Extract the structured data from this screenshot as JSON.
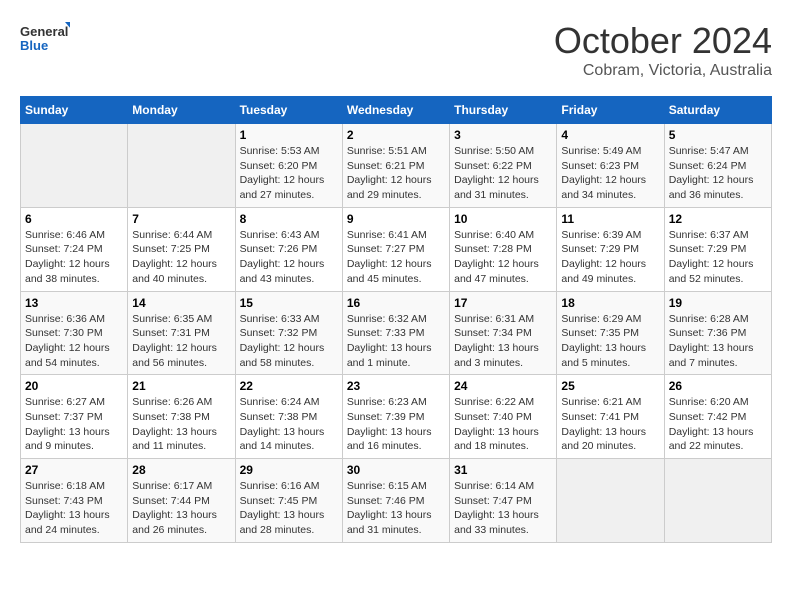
{
  "header": {
    "logo_line1": "General",
    "logo_line2": "Blue",
    "month_title": "October 2024",
    "location": "Cobram, Victoria, Australia"
  },
  "days_of_week": [
    "Sunday",
    "Monday",
    "Tuesday",
    "Wednesday",
    "Thursday",
    "Friday",
    "Saturday"
  ],
  "weeks": [
    [
      {
        "day": "",
        "info": ""
      },
      {
        "day": "",
        "info": ""
      },
      {
        "day": "1",
        "info": "Sunrise: 5:53 AM\nSunset: 6:20 PM\nDaylight: 12 hours\nand 27 minutes."
      },
      {
        "day": "2",
        "info": "Sunrise: 5:51 AM\nSunset: 6:21 PM\nDaylight: 12 hours\nand 29 minutes."
      },
      {
        "day": "3",
        "info": "Sunrise: 5:50 AM\nSunset: 6:22 PM\nDaylight: 12 hours\nand 31 minutes."
      },
      {
        "day": "4",
        "info": "Sunrise: 5:49 AM\nSunset: 6:23 PM\nDaylight: 12 hours\nand 34 minutes."
      },
      {
        "day": "5",
        "info": "Sunrise: 5:47 AM\nSunset: 6:24 PM\nDaylight: 12 hours\nand 36 minutes."
      }
    ],
    [
      {
        "day": "6",
        "info": "Sunrise: 6:46 AM\nSunset: 7:24 PM\nDaylight: 12 hours\nand 38 minutes."
      },
      {
        "day": "7",
        "info": "Sunrise: 6:44 AM\nSunset: 7:25 PM\nDaylight: 12 hours\nand 40 minutes."
      },
      {
        "day": "8",
        "info": "Sunrise: 6:43 AM\nSunset: 7:26 PM\nDaylight: 12 hours\nand 43 minutes."
      },
      {
        "day": "9",
        "info": "Sunrise: 6:41 AM\nSunset: 7:27 PM\nDaylight: 12 hours\nand 45 minutes."
      },
      {
        "day": "10",
        "info": "Sunrise: 6:40 AM\nSunset: 7:28 PM\nDaylight: 12 hours\nand 47 minutes."
      },
      {
        "day": "11",
        "info": "Sunrise: 6:39 AM\nSunset: 7:29 PM\nDaylight: 12 hours\nand 49 minutes."
      },
      {
        "day": "12",
        "info": "Sunrise: 6:37 AM\nSunset: 7:29 PM\nDaylight: 12 hours\nand 52 minutes."
      }
    ],
    [
      {
        "day": "13",
        "info": "Sunrise: 6:36 AM\nSunset: 7:30 PM\nDaylight: 12 hours\nand 54 minutes."
      },
      {
        "day": "14",
        "info": "Sunrise: 6:35 AM\nSunset: 7:31 PM\nDaylight: 12 hours\nand 56 minutes."
      },
      {
        "day": "15",
        "info": "Sunrise: 6:33 AM\nSunset: 7:32 PM\nDaylight: 12 hours\nand 58 minutes."
      },
      {
        "day": "16",
        "info": "Sunrise: 6:32 AM\nSunset: 7:33 PM\nDaylight: 13 hours\nand 1 minute."
      },
      {
        "day": "17",
        "info": "Sunrise: 6:31 AM\nSunset: 7:34 PM\nDaylight: 13 hours\nand 3 minutes."
      },
      {
        "day": "18",
        "info": "Sunrise: 6:29 AM\nSunset: 7:35 PM\nDaylight: 13 hours\nand 5 minutes."
      },
      {
        "day": "19",
        "info": "Sunrise: 6:28 AM\nSunset: 7:36 PM\nDaylight: 13 hours\nand 7 minutes."
      }
    ],
    [
      {
        "day": "20",
        "info": "Sunrise: 6:27 AM\nSunset: 7:37 PM\nDaylight: 13 hours\nand 9 minutes."
      },
      {
        "day": "21",
        "info": "Sunrise: 6:26 AM\nSunset: 7:38 PM\nDaylight: 13 hours\nand 11 minutes."
      },
      {
        "day": "22",
        "info": "Sunrise: 6:24 AM\nSunset: 7:38 PM\nDaylight: 13 hours\nand 14 minutes."
      },
      {
        "day": "23",
        "info": "Sunrise: 6:23 AM\nSunset: 7:39 PM\nDaylight: 13 hours\nand 16 minutes."
      },
      {
        "day": "24",
        "info": "Sunrise: 6:22 AM\nSunset: 7:40 PM\nDaylight: 13 hours\nand 18 minutes."
      },
      {
        "day": "25",
        "info": "Sunrise: 6:21 AM\nSunset: 7:41 PM\nDaylight: 13 hours\nand 20 minutes."
      },
      {
        "day": "26",
        "info": "Sunrise: 6:20 AM\nSunset: 7:42 PM\nDaylight: 13 hours\nand 22 minutes."
      }
    ],
    [
      {
        "day": "27",
        "info": "Sunrise: 6:18 AM\nSunset: 7:43 PM\nDaylight: 13 hours\nand 24 minutes."
      },
      {
        "day": "28",
        "info": "Sunrise: 6:17 AM\nSunset: 7:44 PM\nDaylight: 13 hours\nand 26 minutes."
      },
      {
        "day": "29",
        "info": "Sunrise: 6:16 AM\nSunset: 7:45 PM\nDaylight: 13 hours\nand 28 minutes."
      },
      {
        "day": "30",
        "info": "Sunrise: 6:15 AM\nSunset: 7:46 PM\nDaylight: 13 hours\nand 31 minutes."
      },
      {
        "day": "31",
        "info": "Sunrise: 6:14 AM\nSunset: 7:47 PM\nDaylight: 13 hours\nand 33 minutes."
      },
      {
        "day": "",
        "info": ""
      },
      {
        "day": "",
        "info": ""
      }
    ]
  ]
}
